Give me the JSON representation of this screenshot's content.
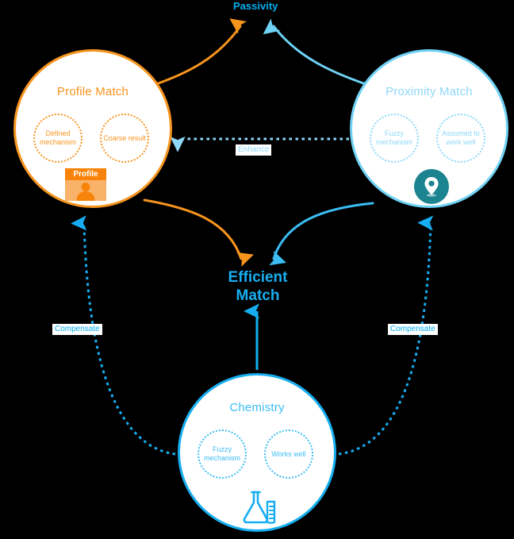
{
  "diagram": {
    "title_center": "Efficient\nMatch",
    "center_line1": "Efficient",
    "center_line2": "Match",
    "top_label": "Passivity",
    "colors": {
      "orange": "#F7941E",
      "orange_dark": "#F7830A",
      "orange_light": "#F9B26A",
      "blue": "#00AEEF",
      "blue_mid": "#16AEF0",
      "blue_light": "#8ED8F8",
      "teal": "#1C8391",
      "background": "#000000",
      "node_fill": "#FFFFFF"
    },
    "nodes": [
      {
        "id": "profile-match",
        "title": "Profile Match",
        "color": "#F7941E",
        "bubbles": [
          "Defined mechanism",
          "Coarse result"
        ],
        "icon": "profile-badge-icon",
        "icon_label": "Profile"
      },
      {
        "id": "proximity-match",
        "title": "Proximity Match",
        "color": "#8ED8F8",
        "bubbles": [
          "Fuzzy mechanism",
          "Assumed to work well"
        ],
        "icon": "map-pin-icon",
        "icon_label": ""
      },
      {
        "id": "chemistry",
        "title": "Chemistry",
        "color": "#3BBDF4",
        "bubbles": [
          "Fuzzy mechanism",
          "Works well"
        ],
        "icon": "flask-icon",
        "icon_label": ""
      }
    ],
    "edges": [
      {
        "id": "profile-to-passivity",
        "label": "Passivity",
        "style": "solid",
        "color": "#F7941E",
        "from": "profile-match",
        "to": "passivity"
      },
      {
        "id": "proximity-to-passivity",
        "label": "Passivity",
        "style": "solid",
        "color": "#6FD2F5",
        "from": "proximity-match",
        "to": "passivity"
      },
      {
        "id": "proximity-to-profile",
        "label": "Enhance",
        "style": "dotted",
        "color": "#8ED8F8",
        "from": "proximity-match",
        "to": "profile-match"
      },
      {
        "id": "profile-to-efficient",
        "label": "",
        "style": "solid",
        "color": "#F7941E",
        "from": "profile-match",
        "to": "efficient-match"
      },
      {
        "id": "proximity-to-efficient",
        "label": "",
        "style": "solid",
        "color": "#3BBDF4",
        "from": "proximity-match",
        "to": "efficient-match"
      },
      {
        "id": "chemistry-to-efficient",
        "label": "",
        "style": "solid",
        "color": "#16AEF0",
        "from": "chemistry",
        "to": "efficient-match"
      },
      {
        "id": "chemistry-to-profile",
        "label": "Compensate",
        "style": "dotted",
        "color": "#16AEF0",
        "from": "chemistry",
        "to": "profile-match"
      },
      {
        "id": "chemistry-to-proximity",
        "label": "Compensate",
        "style": "dotted",
        "color": "#16AEF0",
        "from": "chemistry",
        "to": "proximity-match"
      }
    ],
    "labels": {
      "enhance": "Enhance",
      "compensate_left": "Compensate",
      "compensate_right": "Compensate"
    }
  }
}
